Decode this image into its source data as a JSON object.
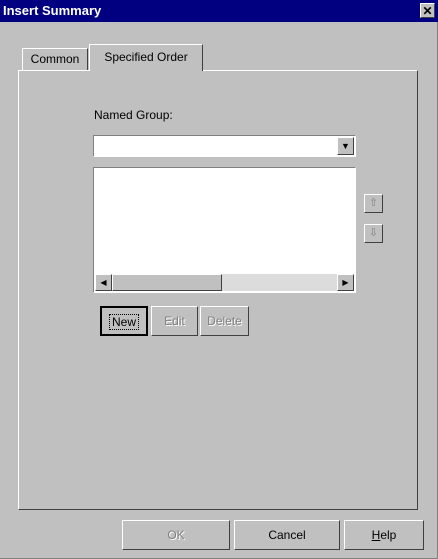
{
  "window": {
    "title": "Insert Summary",
    "close_glyph": "✕"
  },
  "tabs": [
    {
      "label": "Common",
      "active": false
    },
    {
      "label": "Specified Order",
      "active": true
    }
  ],
  "form": {
    "named_group_label": "Named Group:",
    "named_group_value": "",
    "list_items": []
  },
  "list_buttons": {
    "new": "New",
    "edit": "Edit",
    "delete": "Delete"
  },
  "footer": {
    "ok": "OK",
    "cancel": "Cancel",
    "help_prefix": "H",
    "help_rest": "elp"
  },
  "icons": {
    "dropdown": "▼",
    "move_up": "⇧",
    "move_down": "⇩",
    "scroll_left": "◀",
    "scroll_right": "▶"
  },
  "colors": {
    "title_bar": "#000080",
    "face": "#c0c0c0"
  }
}
